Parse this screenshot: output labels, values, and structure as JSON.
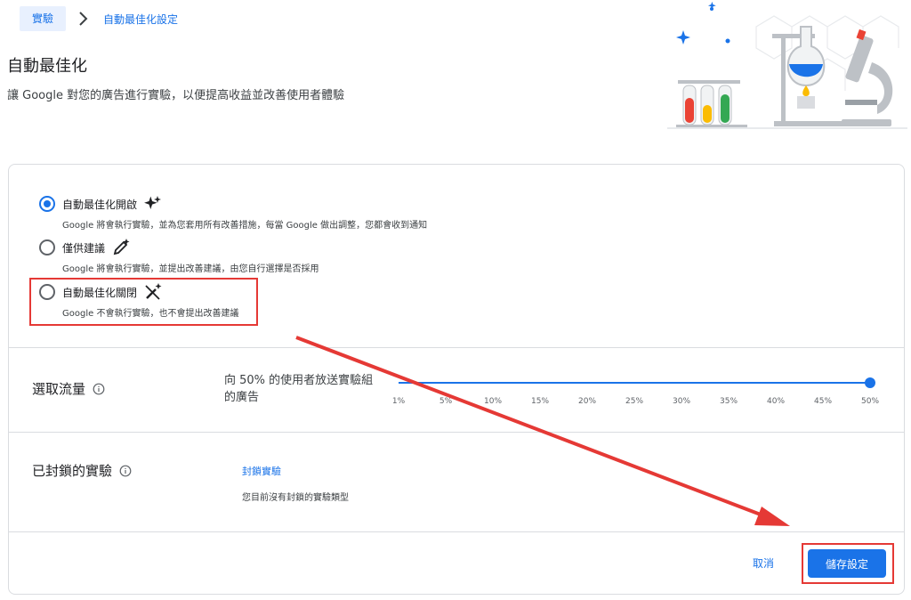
{
  "breadcrumb": {
    "root": "實驗",
    "current": "自動最佳化設定"
  },
  "header": {
    "title": "自動最佳化",
    "subtitle": "讓 Google 對您的廣告進行實驗，以便提高收益並改善使用者體驗"
  },
  "options": [
    {
      "label": "自動最佳化開啟",
      "description": "Google 將會執行實驗，並為您套用所有改善措施，每當 Google 做出調整，您都會收到通知",
      "icon": "sparkle-icon",
      "selected": true
    },
    {
      "label": "僅供建議",
      "description": "Google 將會執行實驗，並提出改善建議，由您自行選擇是否採用",
      "icon": "pencil-sparkle-icon",
      "selected": false
    },
    {
      "label": "自動最佳化關閉",
      "description": "Google 不會執行實驗，也不會提出改善建議",
      "icon": "wand-off-icon",
      "selected": false
    }
  ],
  "traffic": {
    "label": "選取流量",
    "description": "向 50% 的使用者放送實驗組的廣告",
    "value_percent": 50,
    "ticks": [
      "1%",
      "5%",
      "10%",
      "15%",
      "20%",
      "25%",
      "30%",
      "35%",
      "40%",
      "45%",
      "50%"
    ]
  },
  "blocked": {
    "label": "已封鎖的實驗",
    "link": "封鎖實驗",
    "empty_text": "您目前沒有封鎖的實驗類型"
  },
  "footer": {
    "cancel": "取消",
    "save": "儲存設定"
  },
  "colors": {
    "accent": "#1a73e8",
    "annotation": "#e53935"
  }
}
